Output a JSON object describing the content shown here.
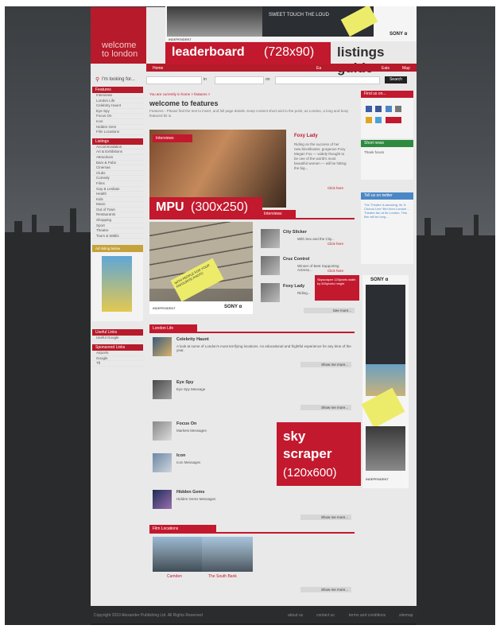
{
  "site": {
    "logo_line1": "welcome",
    "logo_line2": "to london",
    "title_fragment": "listings guide"
  },
  "nav": {
    "items": [
      "Home",
      "Ea",
      "Eats",
      "Map"
    ],
    "search_prompt": "I'm looking for...",
    "search_in_label": "in",
    "search_on_label": "on",
    "search_button": "Search"
  },
  "ads": {
    "leaderboard": {
      "name": "leaderboard",
      "size": "(728x90)"
    },
    "mpu": {
      "name": "MPU",
      "size": "(300x250)"
    },
    "skyscraper": {
      "name_line1": "sky",
      "name_line2": "scraper",
      "size": "(120x600)"
    },
    "brand_sony": "SONY α",
    "brand_independent_line1": "THE ▼",
    "brand_independent_line2": "INDEPENDENT",
    "sticky_note": "WITH PEOPLE FOR YOUR FAVOURITE PHOTO",
    "headline": "SWEET TOUCH THE LOUD",
    "sky_red_text": "Skyscraper 120pixels width by 600pixels height"
  },
  "breadcrumb": "You are currently in home > features >",
  "main": {
    "heading": "welcome to features",
    "intro": "Features - Please find the text to insert, and full page details. Keep content short and to the point, as London, a long and busy featured bit is.",
    "interviews_tab": "Interviews",
    "feature_title": "Foxy Lady",
    "feature_body": "Riding on the success of her new blockbuster, gorgeous Foxy Megan Fox — widely thought to be one of the world's most beautiful women — will be hitting the big...",
    "feature_more": "Click here",
    "interviews_header": "Interviews",
    "interview_items": [
      {
        "title": "City Slicker",
        "desc": "With Sex and the City...",
        "more": "Click here"
      },
      {
        "title": "Cruz Control",
        "desc": "Winner of Best Supporting Actress...",
        "more": "Click here"
      },
      {
        "title": "Foxy Lady",
        "desc": "Riding...",
        "more": ""
      }
    ],
    "see_more": "See more...",
    "london_life_header": "London Life",
    "london_items": [
      {
        "title": "Celebrity Haunt",
        "desc": "A look at some of London's most terrifying locations. An educational and frightful experience for any time of the year.",
        "more": "Show me more..."
      },
      {
        "title": "Eye Spy",
        "desc": "Eye Spy Message",
        "more": "Show me more..."
      },
      {
        "title": "Focus On",
        "desc": "Markets Messages",
        "more": "Show me more..."
      },
      {
        "title": "Icon",
        "desc": "Icon Messages",
        "more": "Show me more..."
      },
      {
        "title": "Hidden Gems",
        "desc": "Hidden Gems Messages",
        "more": "Show me more..."
      }
    ],
    "film_header": "Film Locations",
    "film_items": [
      "Camden",
      "The South Bank"
    ],
    "film_more": "Show me more..."
  },
  "sidebar": {
    "features_header": "Features",
    "features_links": [
      "Interviews",
      "London Life",
      "Celebrity Haunt",
      "Eye Spy",
      "Focus On",
      "Icon",
      "Hidden Gem",
      "Film Locations"
    ],
    "listings_header": "Listings",
    "listings_links": [
      "Accommodation",
      "Art & Exhibitions",
      "Attractions",
      "Bars & Pubs",
      "Cinemas",
      "Clubs",
      "Comedy",
      "Films",
      "Gay & Lesbian",
      "Health",
      "Kids",
      "Music",
      "Out of Town",
      "Restaurants",
      "Shopping",
      "Sport",
      "Theatre",
      "Tours & Walks"
    ],
    "promo_header": "Ad listing below",
    "useful_header": "Useful Links",
    "useful_links": [
      "Useful Google"
    ],
    "sponsored_header": "Sponsored Links",
    "sponsored_links": [
      "Airports",
      "Google",
      "Tfl"
    ]
  },
  "right": {
    "find_header": "Find us on...",
    "green_header": "Short news",
    "sub_text": "Thank forum",
    "blue_header": "Tell us on twitter",
    "blue_text": "The Theatre is amazing, its 'A Chorus Line' film from London ... Theatre fan at its London. This film will be long ..."
  },
  "footer": {
    "copyright": "Copyright 2010 Alexander Publishing Ltd. All Rights Reserved",
    "links": [
      "about us",
      "contact us",
      "terms and conditions",
      "sitemap"
    ]
  },
  "colors": {
    "brand_red": "#c2192e",
    "page_bg": "#e9e9e9",
    "dark_bg": "#3a3d40"
  }
}
